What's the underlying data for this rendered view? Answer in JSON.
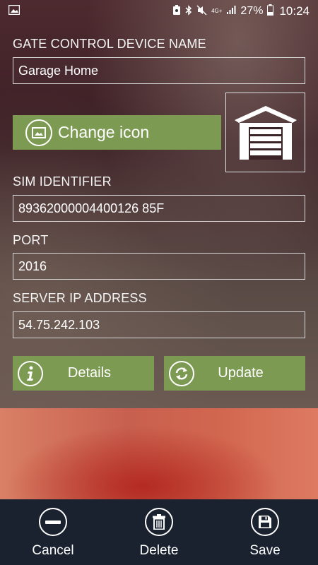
{
  "status_bar": {
    "network_type": "4G+",
    "battery": "27%",
    "time": "10:24"
  },
  "form": {
    "device_name_label": "GATE CONTROL DEVICE NAME",
    "device_name_value": "Garage Home",
    "change_icon_label": "Change icon",
    "sim_label": "SIM IDENTIFIER",
    "sim_value": "89362000004400126 85F",
    "port_label": "PORT",
    "port_value": "2016",
    "server_ip_label": "SERVER IP ADDRESS",
    "server_ip_value": "54.75.242.103"
  },
  "actions": {
    "details_label": "Details",
    "update_label": "Update"
  },
  "bottom_bar": {
    "cancel_label": "Cancel",
    "delete_label": "Delete",
    "save_label": "Save"
  },
  "colors": {
    "button_green": "#7c9a52",
    "bottom_bar": "#1a2230"
  },
  "icons": {
    "device_icon": "garage-icon",
    "change_icon": "image-icon",
    "details": "info-icon",
    "update": "refresh-icon",
    "cancel": "minus-circle-icon",
    "delete": "trash-icon",
    "save": "floppy-icon"
  }
}
